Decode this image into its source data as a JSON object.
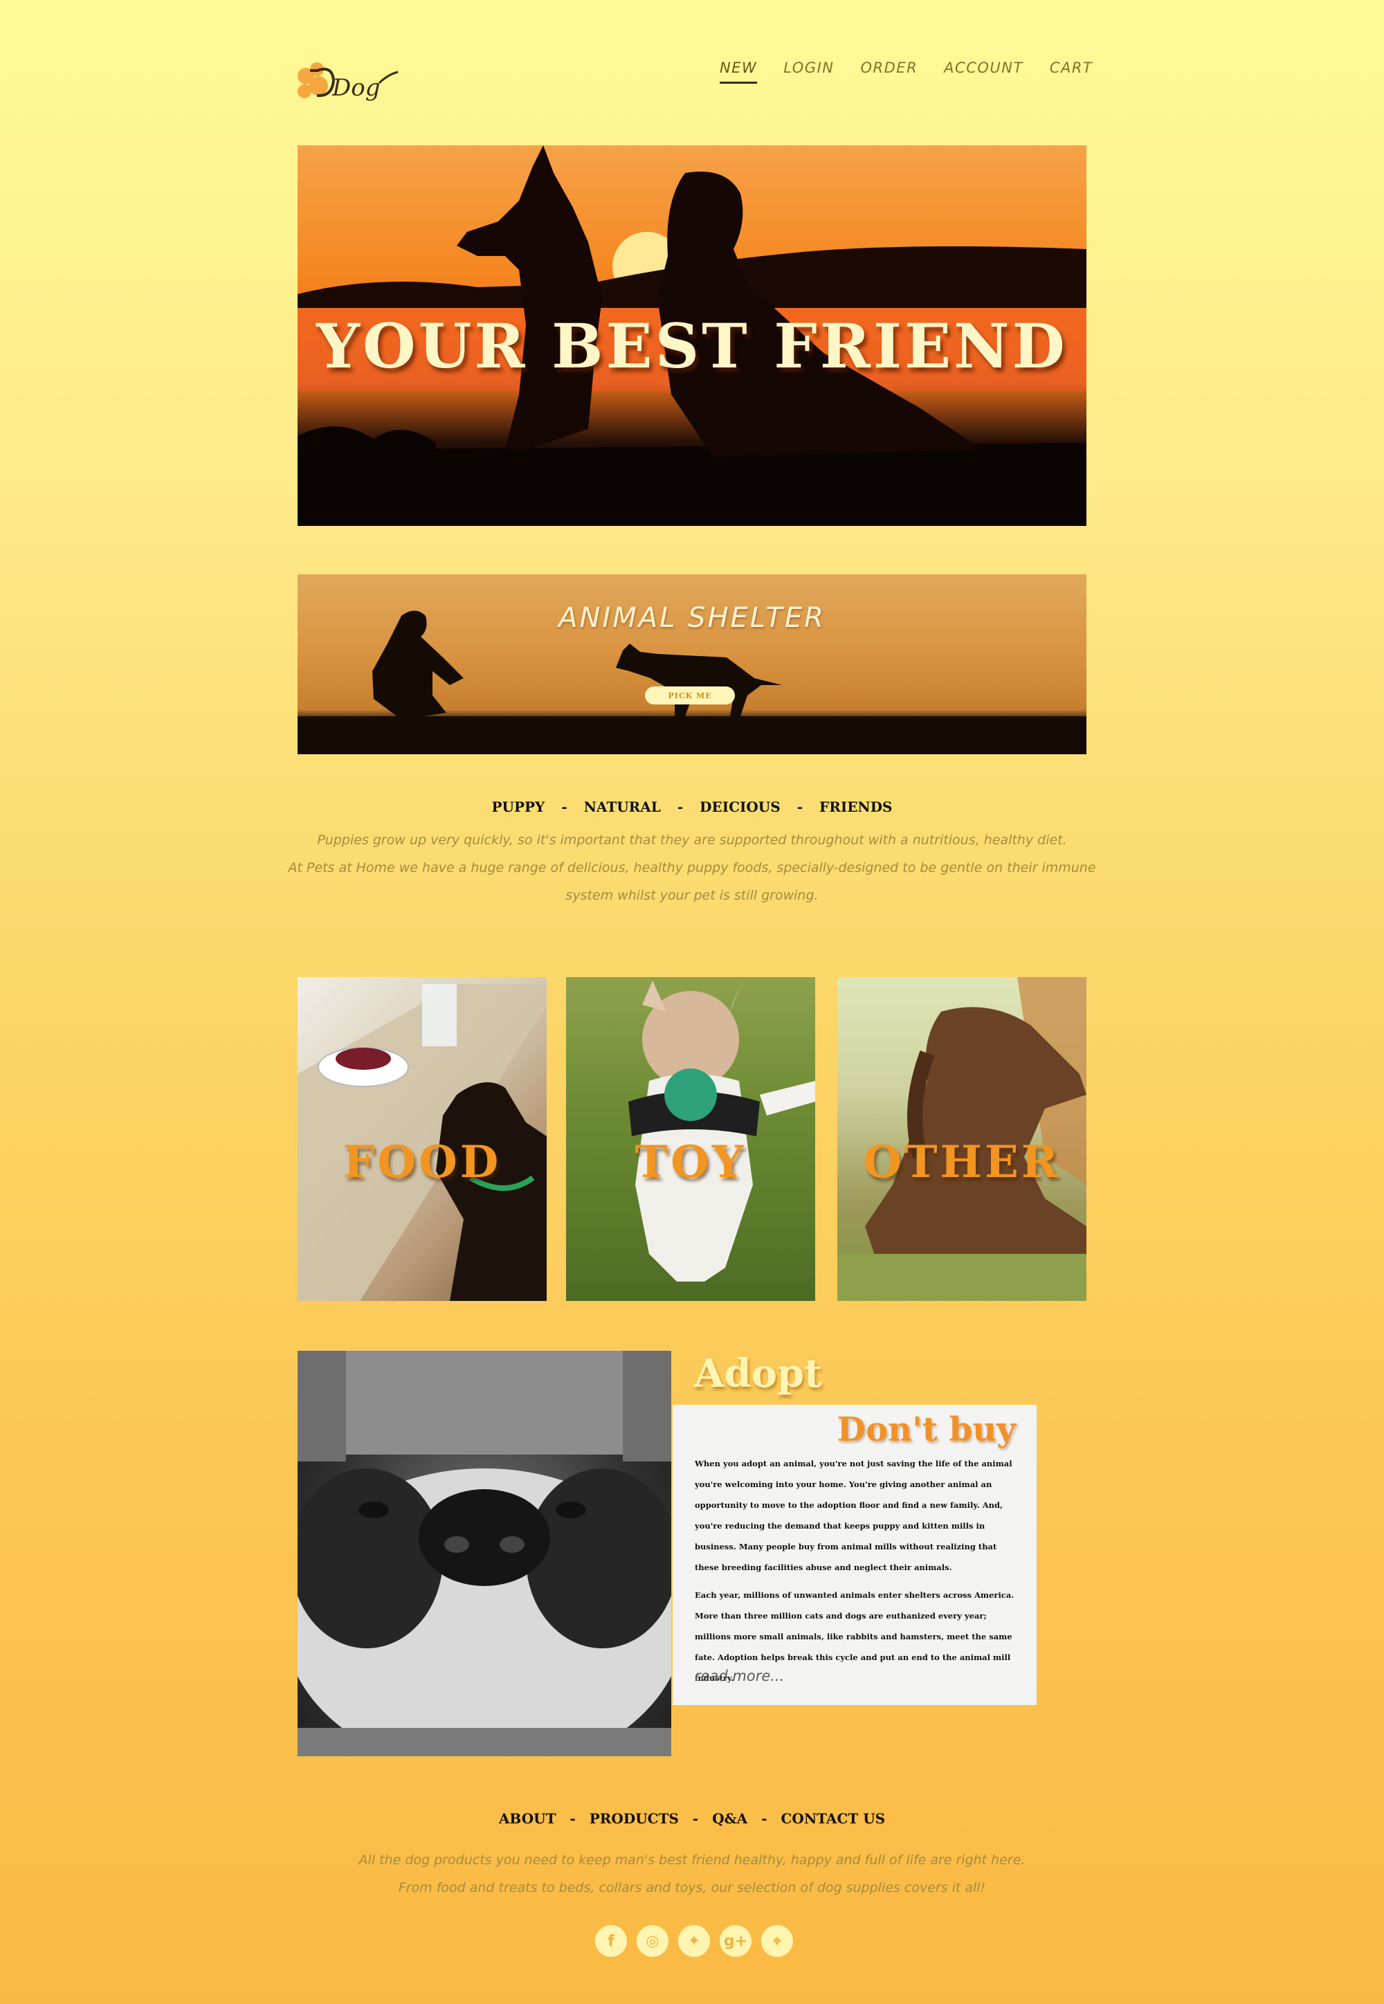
{
  "header": {
    "logo_text": "Dog",
    "nav": [
      {
        "label": "NEW",
        "active": true
      },
      {
        "label": "LOGIN"
      },
      {
        "label": "ORDER"
      },
      {
        "label": "ACCOUNT"
      },
      {
        "label": "CART"
      }
    ]
  },
  "hero": {
    "title": "YOUR BEST FRIEND"
  },
  "shelter": {
    "title": "ANIMAL SHELTER",
    "button": "PICK ME"
  },
  "tags": [
    "PUPPY",
    "NATURAL",
    "DEICIOUS",
    "FRIENDS"
  ],
  "intro": {
    "line1": "Puppies grow up very quickly, so it's important that they are supported throughout with a nutritious, healthy diet.",
    "line2": "At Pets at Home we have a huge range of delicious, healthy puppy foods, specially-designed to be gentle on their immune system whilst your pet is still growing."
  },
  "categories": [
    {
      "label": "FOOD"
    },
    {
      "label": "TOY"
    },
    {
      "label": "OTHER"
    }
  ],
  "adopt": {
    "title": "Adopt",
    "subtitle": "Don't buy",
    "paragraph1": "When you adopt an animal, you're not just saving the life of the animal you're welcoming into your home. You're giving another animal an opportunity to move to the adoption floor and find a new family. And, you're reducing the demand that keeps puppy and kitten mills in business. Many people buy from animal mills without realizing that these breeding facilities abuse and neglect their animals.",
    "paragraph2": "Each year, millions of unwanted animals enter shelters across America. More than three million cats and dogs are euthanized every year; millions more small animals, like rabbits and hamsters, meet the same fate. Adoption helps break this cycle and put an end to the animal mill industry.",
    "read_more": "read more..."
  },
  "footer": {
    "links": [
      "ABOUT",
      "PRODUCTS",
      "Q&A",
      "CONTACT US"
    ],
    "line1": "All the dog products you need to keep man's best friend healthy, happy and full of life are right here.",
    "line2": "From food and treats to beds, collars and toys, our selection of dog supplies covers it all!",
    "socials": [
      {
        "icon": "facebook-icon",
        "glyph": "f"
      },
      {
        "icon": "instagram-icon",
        "glyph": "◎"
      },
      {
        "icon": "twitter-icon",
        "glyph": "✦"
      },
      {
        "icon": "google-plus-icon",
        "glyph": "g+"
      },
      {
        "icon": "location-icon",
        "glyph": "⌖"
      }
    ]
  },
  "colors": {
    "accent_orange": "#f29521",
    "cream": "#fff4b3",
    "bg_top": "#fffa97",
    "bg_bottom": "#fab943",
    "muted_text": "#a38b3e"
  }
}
